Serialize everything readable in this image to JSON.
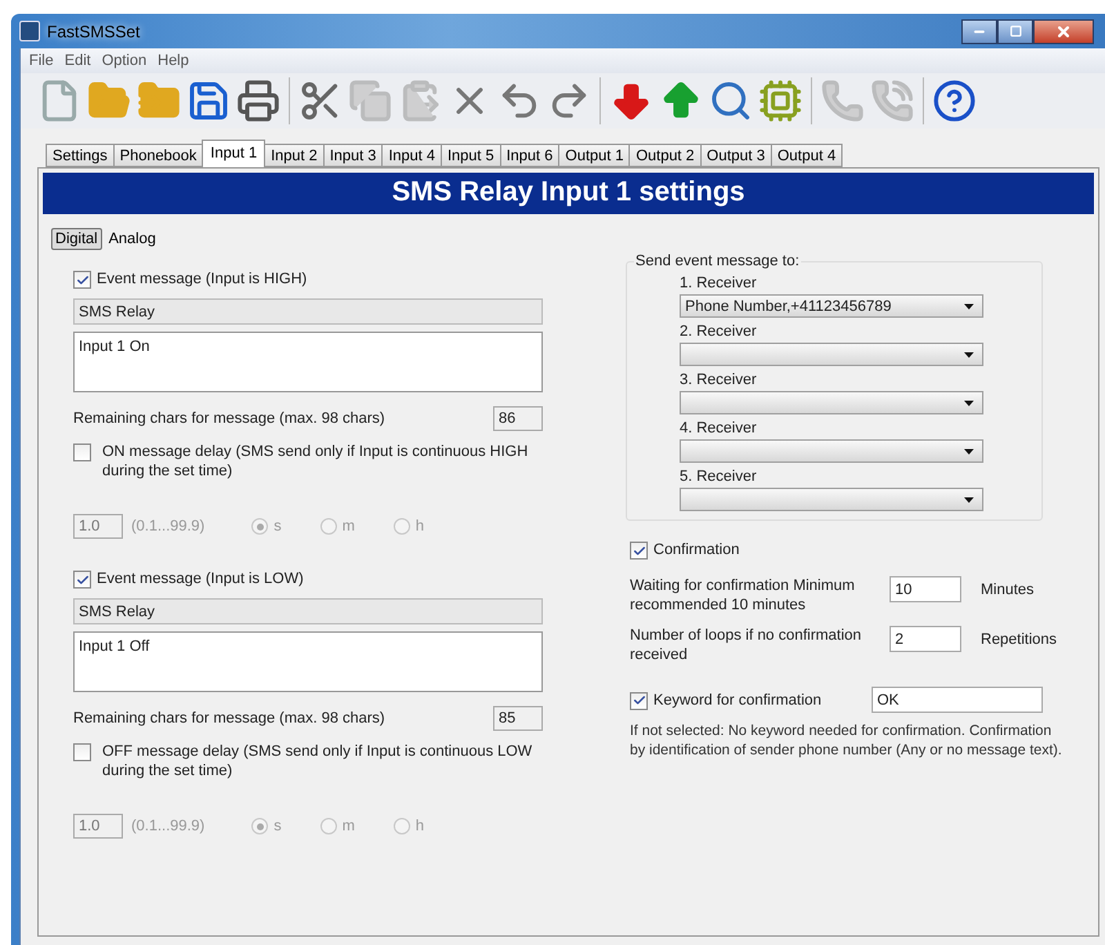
{
  "window": {
    "title": "FastSMSSet"
  },
  "menu": [
    "File",
    "Edit",
    "Option",
    "Help"
  ],
  "toolbar": [
    {
      "kind": "new",
      "disabled": false
    },
    {
      "kind": "open",
      "disabled": false
    },
    {
      "kind": "reload",
      "disabled": false
    },
    {
      "kind": "save",
      "disabled": false
    },
    {
      "kind": "print",
      "disabled": false
    },
    {
      "kind": "separator"
    },
    {
      "kind": "cut",
      "disabled": false
    },
    {
      "kind": "copy",
      "disabled": true
    },
    {
      "kind": "paste",
      "disabled": true
    },
    {
      "kind": "delete",
      "disabled": false
    },
    {
      "kind": "undo",
      "disabled": false
    },
    {
      "kind": "redo",
      "disabled": false
    },
    {
      "kind": "separator"
    },
    {
      "kind": "download",
      "disabled": false
    },
    {
      "kind": "upload",
      "disabled": false
    },
    {
      "kind": "search",
      "disabled": false
    },
    {
      "kind": "device",
      "disabled": false
    },
    {
      "kind": "separator"
    },
    {
      "kind": "phone",
      "disabled": true
    },
    {
      "kind": "call",
      "disabled": true
    },
    {
      "kind": "separator"
    },
    {
      "kind": "help",
      "disabled": false
    }
  ],
  "tabs": [
    {
      "label": "Settings",
      "selected": false
    },
    {
      "label": "Phonebook",
      "selected": false
    },
    {
      "label": "Input 1",
      "selected": true
    },
    {
      "label": "Input 2",
      "selected": false
    },
    {
      "label": "Input 3",
      "selected": false
    },
    {
      "label": "Input 4",
      "selected": false
    },
    {
      "label": "Input 5",
      "selected": false
    },
    {
      "label": "Input 6",
      "selected": false
    },
    {
      "label": "Output 1",
      "selected": false
    },
    {
      "label": "Output 2",
      "selected": false
    },
    {
      "label": "Output 3",
      "selected": false
    },
    {
      "label": "Output 4",
      "selected": false
    }
  ],
  "header": "SMS Relay Input 1 settings",
  "mode_tabs": [
    {
      "label": "Digital",
      "selected": true
    },
    {
      "label": "Analog",
      "selected": false
    }
  ],
  "events": [
    {
      "checked": true,
      "label": "Event message (Input is HIGH)",
      "sender": "SMS Relay",
      "message": "Input 1 On",
      "remaining_label": "Remaining chars for message (max. 98 chars)",
      "remaining": "86",
      "delay": {
        "checked": false,
        "label": "ON message delay (SMS send only if Input is continuous HIGH during the set time)",
        "value": "1.0",
        "range": "(0.1...99.9)",
        "units": [
          {
            "label": "s",
            "selected": true
          },
          {
            "label": "m",
            "selected": false
          },
          {
            "label": "h",
            "selected": false
          }
        ]
      }
    },
    {
      "checked": true,
      "label": "Event message (Input is LOW)",
      "sender": "SMS Relay",
      "message": "Input 1 Off",
      "remaining_label": "Remaining chars for message (max. 98 chars)",
      "remaining": "85",
      "delay": {
        "checked": false,
        "label": "OFF message delay (SMS send only if Input is continuous LOW during the set time)",
        "value": "1.0",
        "range": "(0.1...99.9)",
        "units": [
          {
            "label": "s",
            "selected": true
          },
          {
            "label": "m",
            "selected": false
          },
          {
            "label": "h",
            "selected": false
          }
        ]
      }
    }
  ],
  "receivers": {
    "title": "Send event message to:",
    "items": [
      {
        "label": "1. Receiver",
        "value": "Phone Number,+41123456789"
      },
      {
        "label": "2. Receiver"
      },
      {
        "label": "3. Receiver"
      },
      {
        "label": "4. Receiver"
      },
      {
        "label": "5. Receiver"
      }
    ]
  },
  "confirmation": {
    "checked": true,
    "label": "Confirmation",
    "rows": [
      {
        "label": "Waiting for confirmation Minimum recommended 10 minutes",
        "value": "10",
        "unit": "Minutes"
      },
      {
        "label": "Number of loops if no confirmation received",
        "value": "2",
        "unit": "Repetitions"
      }
    ],
    "keyword": {
      "checked": true,
      "label": "Keyword for confirmation",
      "value": "OK"
    },
    "note": "If not selected: No keyword needed for confirmation.  Confirmation by identification of sender phone number (Any or no message text)."
  }
}
